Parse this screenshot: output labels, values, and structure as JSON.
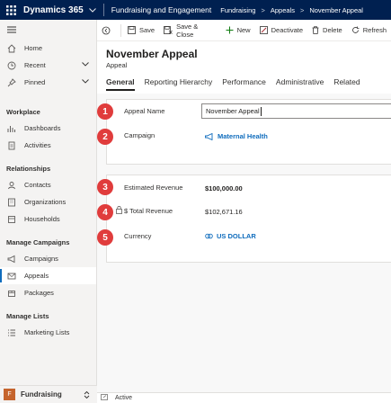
{
  "topbar": {
    "app_name": "Dynamics 365",
    "app_module": "Fundraising and Engagement",
    "breadcrumb": [
      "Fundraising",
      "Appeals",
      "November Appeal"
    ]
  },
  "sidebar": {
    "top_items": [
      {
        "label": "Home",
        "icon": "home-icon"
      },
      {
        "label": "Recent",
        "icon": "clock-icon"
      },
      {
        "label": "Pinned",
        "icon": "pin-icon"
      }
    ],
    "groups": [
      {
        "title": "Workplace",
        "items": [
          {
            "label": "Dashboards",
            "icon": "dashboard-icon"
          },
          {
            "label": "Activities",
            "icon": "activities-icon"
          }
        ]
      },
      {
        "title": "Relationships",
        "items": [
          {
            "label": "Contacts",
            "icon": "contact-icon"
          },
          {
            "label": "Organizations",
            "icon": "organization-icon"
          },
          {
            "label": "Households",
            "icon": "household-icon"
          }
        ]
      },
      {
        "title": "Manage Campaigns",
        "items": [
          {
            "label": "Campaigns",
            "icon": "campaign-icon"
          },
          {
            "label": "Appeals",
            "icon": "appeal-icon",
            "active": true
          },
          {
            "label": "Packages",
            "icon": "package-icon"
          }
        ]
      },
      {
        "title": "Manage Lists",
        "items": [
          {
            "label": "Marketing Lists",
            "icon": "list-icon"
          }
        ]
      }
    ],
    "area": {
      "badge": "F",
      "label": "Fundraising"
    }
  },
  "commands": {
    "save": "Save",
    "save_close": "Save & Close",
    "new": "New",
    "deactivate": "Deactivate",
    "delete": "Delete",
    "refresh": "Refresh"
  },
  "record": {
    "title": "November Appeal",
    "entity": "Appeal"
  },
  "tabs": [
    "General",
    "Reporting Hierarchy",
    "Performance",
    "Administrative",
    "Related"
  ],
  "fields": {
    "appeal_name": {
      "label": "Appeal Name",
      "value": "November Appeal",
      "badge": "1"
    },
    "campaign": {
      "label": "Campaign",
      "value": "Maternal Health",
      "badge": "2"
    },
    "estimated_revenue": {
      "label": "Estimated Revenue",
      "value": "$100,000.00",
      "badge": "3"
    },
    "total_revenue": {
      "label": "$ Total Revenue",
      "value": "$102,671.16",
      "badge": "4"
    },
    "currency": {
      "label": "Currency",
      "value": "US DOLLAR",
      "badge": "5"
    }
  },
  "status": {
    "text": "Active"
  },
  "colors": {
    "topbar": "#002050",
    "accent": "#0f6cbd",
    "badge": "#e03c3c",
    "area_badge": "#c5642d"
  }
}
